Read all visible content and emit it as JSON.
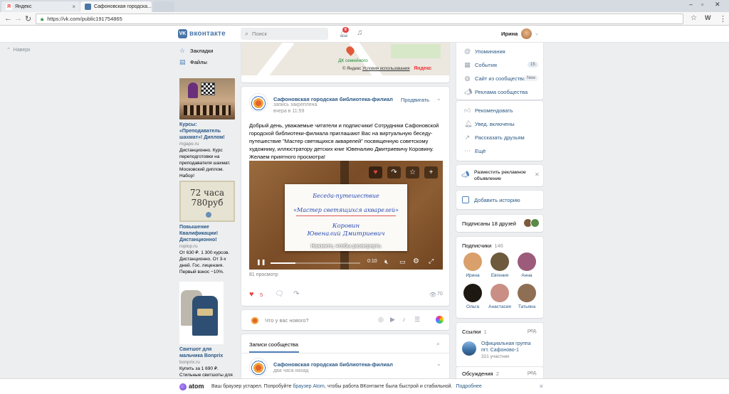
{
  "browser": {
    "tabs": [
      {
        "title": "Яндекс"
      },
      {
        "title": "Сафоновская городска..."
      }
    ],
    "url": "https://vk.com/public191754865"
  },
  "header": {
    "logo_text": "вконтакте",
    "search_placeholder": "Поиск",
    "notifications_count": "8",
    "user_name": "Ирина"
  },
  "left": {
    "back_to_top": "Наверх",
    "menu": [
      {
        "label": "Закладки",
        "icon": "star-icon"
      },
      {
        "label": "Файлы",
        "icon": "file-icon"
      }
    ],
    "ads": [
      {
        "title": "Курсы: «Преподаватель шахмат»! Диплом!",
        "domain": "mgape.ru",
        "text": "Дистанционно. Курс переподготовки на преподавателя шахмат. Московский диплом. Набор!"
      },
      {
        "title": "Повышение Квалификации! Дистанционно!",
        "domain": "roplop.ru",
        "text": "От 630 ₽. 1 300 курсов. Дистанционно. От 3-х дней. Гос. лицензия. Первый взнос −10%.",
        "img_line1": "72 часа",
        "img_line2": "780руб"
      },
      {
        "title": "Свитшот для мальчика Bonprix",
        "domain": "bonprix.ru",
        "text": "Купить за 1 690 ₽. Стильные свитшоты для"
      }
    ]
  },
  "map": {
    "poi": "ДК семейного",
    "copyright": "© Яндекс",
    "terms": "Условия использования",
    "brand": "Яндекс"
  },
  "post": {
    "author": "Сафоновская городская библиотека-филиал",
    "pinned": "запись закреплена",
    "time": "вчера в 11:59",
    "promote": "Продвигать",
    "text": "Добрый день, уважаемые читатели и подписчики! Сотрудники Сафоновской городской библиотеки-филиала приглашают Вас на виртуальную беседу-путешествие \"Мастер светящихся акварелей\" посвященную советскому художнику, иллюстратору детских книг Ювеналию Дмитриевичу Коровину. Желаем приятного просмотра!",
    "video": {
      "line1": "Беседа-путешествие",
      "line2": "«Мастер светящихся акварелей»",
      "line3": "Коровин",
      "line4": "Ювеналий Дмитриевич",
      "caption": "Нажмите, чтобы развернуть",
      "time": "0:10",
      "progress": 0.28
    },
    "views_text": "81 просмотр",
    "likes": "5",
    "eye_views": "70"
  },
  "composer": {
    "placeholder": "Что у вас нового?"
  },
  "wall": {
    "tab": "Записи сообщества",
    "author": "Сафоновская городская библиотека-филиал",
    "time": "два часа назад"
  },
  "sidebar": {
    "menu1": [
      {
        "label": "Упоминания",
        "icon": "mention-icon"
      },
      {
        "label": "События",
        "icon": "calendar-icon",
        "badge": "15"
      },
      {
        "label": "Сайт из сообщества",
        "icon": "globe-icon",
        "badge": "New"
      },
      {
        "label": "Реклама сообщества",
        "icon": "megaphone-icon"
      }
    ],
    "menu2": [
      {
        "label": "Рекомендовать",
        "icon": "thumb-icon"
      },
      {
        "label": "Увед. включены",
        "icon": "bell-icon"
      },
      {
        "label": "Рассказать друзьям",
        "icon": "share-icon"
      },
      {
        "label": "Ещё",
        "icon": "more-icon"
      }
    ],
    "promo": "Разместить рекламное объявление",
    "add_story": "Добавить историю",
    "friends_sub": "Подписаны 18 друзей",
    "subscribers_title": "Подписчики",
    "subscribers_count": "146",
    "subscribers": [
      {
        "name": "Ирина",
        "color": "#d9a06b"
      },
      {
        "name": "Евгения",
        "color": "#6e5a3c"
      },
      {
        "name": "Анна",
        "color": "#9c5b7a"
      },
      {
        "name": "Ольга",
        "color": "#1d1812"
      },
      {
        "name": "Анастасия",
        "color": "#c98f84"
      },
      {
        "name": "Татьяна",
        "color": "#8f6f54"
      }
    ],
    "links_title": "Ссылки",
    "links_count": "1",
    "edit": "ред.",
    "link_name": "Официальная группа пгт. Сафоново-1",
    "link_members": "321 участник",
    "discussions_title": "Обсуждения",
    "discussions_count": "2"
  },
  "atom": {
    "brand": "atom",
    "text_before": "Ваш браузер устарел. Попробуйте ",
    "link": "браузер Atom",
    "text_after": ", чтобы работа ВКонтакте была быстрой и стабильной.",
    "more": "Подробнее"
  },
  "colors": {
    "vk_blue": "#4a76a8",
    "link": "#2a5885",
    "like_red": "#e64646"
  }
}
